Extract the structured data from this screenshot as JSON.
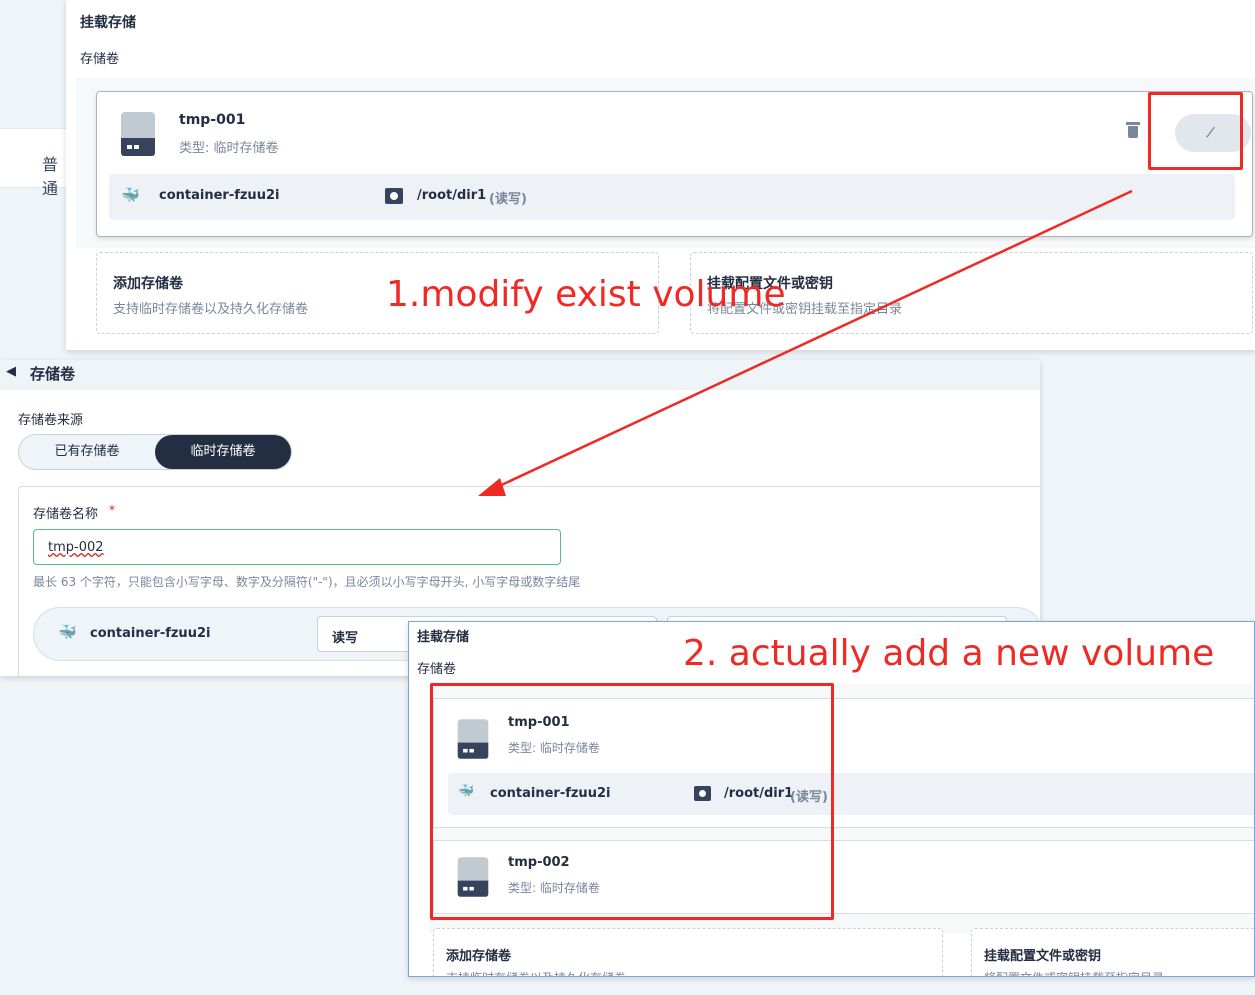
{
  "top_panel": {
    "section_title": "挂载存储",
    "subsection_title": "存储卷",
    "volume": {
      "name": "tmp-001",
      "type": "类型: 临时存储卷",
      "container": "container-fzuu2i",
      "path": "/root/dir1",
      "mode": "(读写)"
    },
    "add_volume": {
      "title": "添加存储卷",
      "desc": "支持临时存储卷以及持久化存储卷"
    },
    "mount_config": {
      "title": "挂载配置文件或密钥",
      "desc": "将配置文件或密钥挂载至指定目录"
    },
    "background_tab_text": "普通"
  },
  "middle_panel": {
    "back_title": "存储卷",
    "source_label": "存储卷来源",
    "source_options": [
      "已有存储卷",
      "临时存储卷"
    ],
    "selected_source": "临时存储卷",
    "name_label": "存储卷名称",
    "required_mark": "*",
    "name_value": "tmp-002",
    "name_hint": "最长 63 个字符，只能包含小写字母、数字及分隔符(\"-\")，且必须以小写字母开头, 小写字母或数字结尾",
    "container": "container-fzuu2i",
    "access_mode": "读写"
  },
  "bottom_panel": {
    "section_title": "挂载存储",
    "subsection_title": "存储卷",
    "volumes": [
      {
        "name": "tmp-001",
        "type": "类型: 临时存储卷",
        "container": "container-fzuu2i",
        "path": "/root/dir1",
        "mode": "(读写)"
      },
      {
        "name": "tmp-002",
        "type": "类型: 临时存储卷"
      }
    ],
    "add_volume": {
      "title": "添加存储卷",
      "desc": "支持临时存储卷以及持久化存储卷"
    },
    "mount_config": {
      "title": "挂载配置文件或密钥",
      "desc": "将配置文件或密钥挂载至指定目录"
    }
  },
  "annotations": {
    "step1": "1.modify exist volume",
    "step2": "2. actually add a new volume"
  },
  "colors": {
    "annotation_red": "#ee2a24",
    "accent_dark": "#242e42",
    "input_border": "#55bc8a"
  }
}
